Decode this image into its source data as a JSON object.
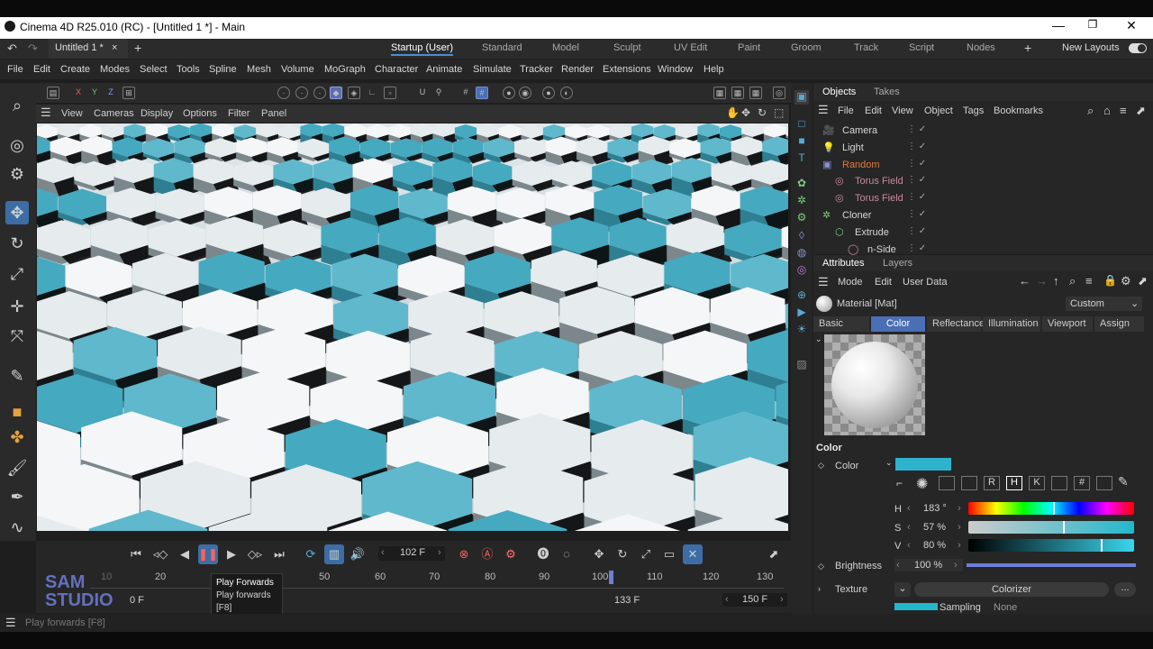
{
  "window": {
    "title": "Cinema 4D R25.010 (RC) - [Untitled 1 *] - Main"
  },
  "tabbar": {
    "doc_tab": "Untitled 1 *",
    "doc_close": "×",
    "add": "+",
    "layouts": [
      "Startup (User)",
      "Standard",
      "Model",
      "Sculpt",
      "UV Edit",
      "Paint",
      "Groom",
      "Track",
      "Script",
      "Nodes"
    ],
    "new_layouts": "New Layouts"
  },
  "menu": [
    "File",
    "Edit",
    "Create",
    "Modes",
    "Select",
    "Tools",
    "Spline",
    "Mesh",
    "Volume",
    "MoGraph",
    "Character",
    "Animate",
    "Simulate",
    "Tracker",
    "Render",
    "Extensions",
    "Window",
    "Help"
  ],
  "toolbar": {
    "axes": [
      "X",
      "Y",
      "Z"
    ]
  },
  "viewport_menu": [
    "View",
    "Cameras",
    "Display",
    "Options",
    "Filter",
    "Panel"
  ],
  "objects": {
    "tabs": [
      "Objects",
      "Takes"
    ],
    "menu": [
      "File",
      "Edit",
      "View",
      "Object",
      "Tags",
      "Bookmarks"
    ],
    "items": [
      {
        "name": "Camera",
        "color": "#d8d8d8"
      },
      {
        "name": "Light",
        "color": "#d8d8d8"
      },
      {
        "name": "Random",
        "color": "#e07a3a"
      },
      {
        "name": "Torus Field",
        "color": "#c98a9a"
      },
      {
        "name": "Torus Field",
        "color": "#c98a9a"
      },
      {
        "name": "Cloner",
        "color": "#d8d8d8"
      },
      {
        "name": "Extrude",
        "color": "#d8d8d8"
      },
      {
        "name": "n-Side",
        "color": "#d8d8d8"
      }
    ]
  },
  "attributes": {
    "tabs": [
      "Attributes",
      "Layers"
    ],
    "menu": [
      "Mode",
      "Edit",
      "User Data"
    ],
    "material": "Material [Mat]",
    "preset": "Custom",
    "subtabs": [
      "Basic",
      "Color",
      "Reflectance",
      "Illumination",
      "Viewport",
      "Assign"
    ],
    "active_subtab": "Color",
    "section": "Color",
    "color_label": "Color",
    "swatch": "#2fb3cc",
    "h_label": "H",
    "h_value": "183 °",
    "h_level": 0.51,
    "s_label": "S",
    "s_value": "57 %",
    "s_level": 0.57,
    "v_label": "V",
    "v_value": "80 %",
    "v_level": 0.8,
    "brightness_label": "Brightness",
    "brightness_value": "100 %",
    "brightness_level": 1.0,
    "texture_label": "Texture",
    "texture_button": "Colorizer",
    "texture_more": "...",
    "sampling_label": "Sampling",
    "sampling_value": "None",
    "mode_buttons": [
      "R",
      "H",
      "K"
    ]
  },
  "timeline": {
    "current_frame": "102 F",
    "ruler": [
      "20",
      "50",
      "60",
      "70",
      "80",
      "90",
      "100",
      "110",
      "120",
      "130"
    ],
    "start": "0 F",
    "end_left": "133 F",
    "end_right": "150 F",
    "playhead_frame": 100
  },
  "tooltip": {
    "title": "Play Forwards",
    "body": "Play forwards",
    "key": "[F8]"
  },
  "status": {
    "text": "Play forwards [F8]"
  },
  "watermark": {
    "line1": "SAM",
    "line2": "STUDIO"
  },
  "colors": {
    "accent": "#4a8fd0",
    "teal": "#2fb3cc"
  }
}
